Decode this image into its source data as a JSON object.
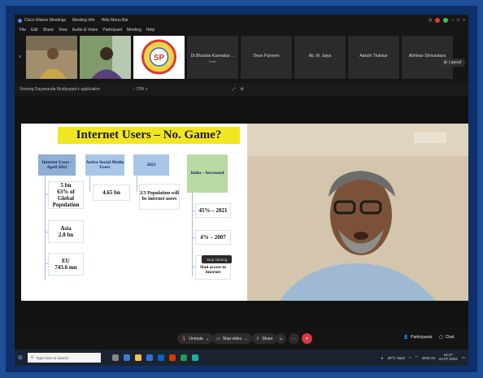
{
  "titlebar": {
    "app_title": "Cisco Webex Meetings",
    "meeting_info": "Meeting Info",
    "hide_menu": "Hide Menu Bar"
  },
  "menubar": [
    "File",
    "Edit",
    "Share",
    "View",
    "Audio & Video",
    "Participant",
    "Meeting",
    "Help"
  ],
  "participants": [
    {
      "name": "",
      "kind": "video"
    },
    {
      "name": "",
      "kind": "video"
    },
    {
      "name": "",
      "kind": "logo"
    },
    {
      "name": "Dr.Bhaskar Karmakar ...",
      "sub": "Host"
    },
    {
      "name": "Dean Parveen"
    },
    {
      "name": "Ab. M. Jaiya"
    },
    {
      "name": "Aakshi Thakkar"
    },
    {
      "name": "Abhinav Shrivastava"
    }
  ],
  "layout_label": "Layout",
  "viewbar": {
    "viewing_text": "Viewing Dayananda Mudiyappa's application",
    "zoom": "− 73% +"
  },
  "slide": {
    "title": "Internet Users – No. Game?",
    "headers": [
      "Internet Users - April 2022",
      "Active Social Media Users",
      "2023",
      "India – Increased"
    ],
    "col1": [
      "5 bn\n63% of Global Population",
      "Asia\n2.8 bn",
      "EU\n743.6 mn"
    ],
    "col2": [
      "4.65 bn"
    ],
    "col3": [
      "2/3 Population will be internet users"
    ],
    "col4": [
      "45% – 2021",
      "4% – 2007",
      "1.37 bn\nHad access to internet"
    ]
  },
  "share_bar": "Stop sharing",
  "controls": {
    "unmute": "Unmute",
    "video": "Stop video",
    "share": "Share",
    "participants": "Participants",
    "chat": "Chat"
  },
  "taskbar": {
    "search_placeholder": "Type here to search",
    "weather": "29°C Haze",
    "lang": "ENG IN",
    "time": "15:47",
    "date": "24-07-2022"
  },
  "colors": {
    "border_blue": "#1f4e98",
    "slide_title_bg": "#f1e622",
    "header1_bg": "#8eaed6",
    "header2_bg": "#a9c5e8",
    "header3_bg": "#a9c5e8",
    "header4_bg": "#b7dba3",
    "end_red": "#d9363e"
  }
}
